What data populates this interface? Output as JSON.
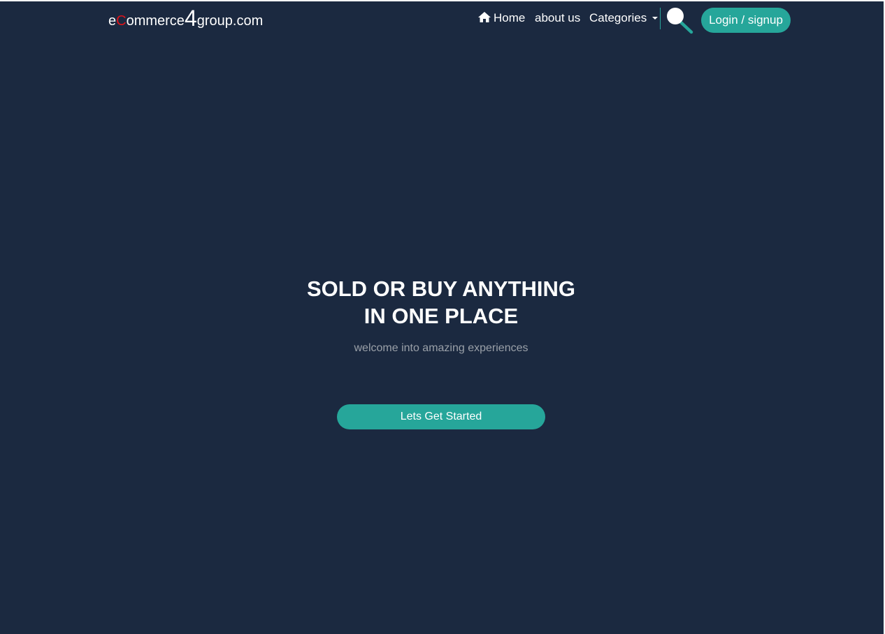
{
  "header": {
    "logo": {
      "part1": "e",
      "part2": "C",
      "part3": "ommerce",
      "part4": "4",
      "part5": "group.com"
    },
    "nav": {
      "home_label": "Home",
      "about_label": "about us",
      "categories_label": "Categories"
    },
    "login_label": "Login / signup"
  },
  "hero": {
    "title_line1": "SOLD OR BUY ANYTHING",
    "title_line2": "IN ONE PLACE",
    "subtitle": "welcome into amazing experiences",
    "cta_label": "Lets Get Started"
  },
  "icons": [
    "home-icon",
    "chevron-down-icon",
    "search-icon"
  ],
  "colors": {
    "background": "#1b2940",
    "accent": "#26a69a",
    "logo_accent": "#e0141a",
    "text": "#ffffff",
    "subtitle": "#9aa0a8"
  }
}
